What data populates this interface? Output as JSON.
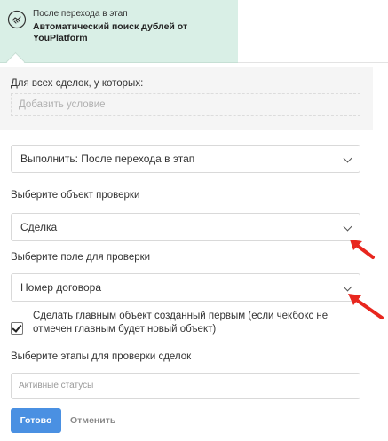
{
  "header": {
    "subtitle": "После перехода в этап",
    "title": "Автоматический поиск дублей от YouPlatform",
    "icon": "handshake-icon"
  },
  "conditions": {
    "label": "Для всех сделок, у которых:",
    "placeholder": "Добавить условие"
  },
  "trigger": {
    "value": "Выполнить: После перехода в этап"
  },
  "check_object": {
    "label": "Выберите объект проверки",
    "value": "Сделка"
  },
  "check_field": {
    "label": "Выберите поле для проверки",
    "value": "Номер договора"
  },
  "primary_checkbox": {
    "checked": true,
    "label": "Сделать главным объект созданный первым (если чекбокс не отмечен главным будет новый объект)"
  },
  "stages": {
    "label": "Выберите этапы для проверки сделок",
    "placeholder": "Активные статусы"
  },
  "actions": {
    "done": "Готово",
    "cancel": "Отменить"
  },
  "colors": {
    "header_bg": "#d9efe6",
    "primary_button": "#4a90e2",
    "annotation_arrow": "#e8261e"
  }
}
